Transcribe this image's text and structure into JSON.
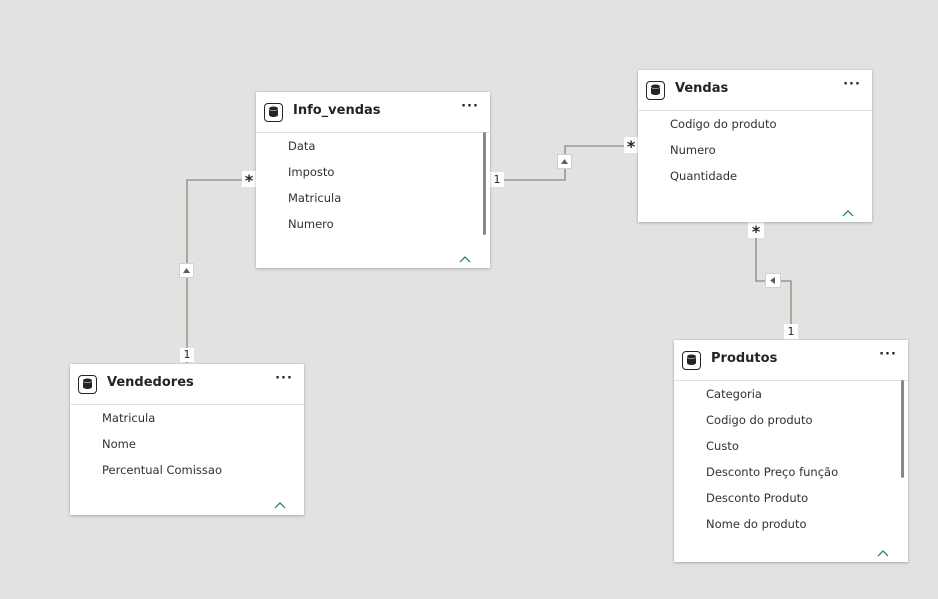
{
  "tables": {
    "info_vendas": {
      "title": "Info_vendas",
      "more": "···",
      "fields": [
        "Data",
        "Imposto",
        "Matricula",
        "Numero"
      ]
    },
    "vendas": {
      "title": "Vendas",
      "more": "···",
      "fields": [
        "Codigo do produto",
        "Numero",
        "Quantidade"
      ]
    },
    "vendedores": {
      "title": "Vendedores",
      "more": "···",
      "fields": [
        "Matricula",
        "Nome",
        "Percentual Comissao"
      ]
    },
    "produtos": {
      "title": "Produtos",
      "more": "···",
      "fields": [
        "Categoria",
        "Codigo do produto",
        "Custo",
        "Desconto Preço função",
        "Desconto Produto",
        "Nome do produto"
      ]
    }
  },
  "relationships": {
    "vendedores_info": {
      "one": "1",
      "many": "*"
    },
    "info_vendas_vendas": {
      "one": "1",
      "many": "*"
    },
    "vendas_produtos": {
      "one": "1",
      "many": "*"
    }
  },
  "colors": {
    "background": "#e3e2e0",
    "line": "#8a8886",
    "accent": "#0f7b6c"
  },
  "icons": {
    "table": "database-icon",
    "more": "more-options-icon",
    "collapse": "chevron-up-icon",
    "filter_direction": "triangle-arrow-icon"
  }
}
